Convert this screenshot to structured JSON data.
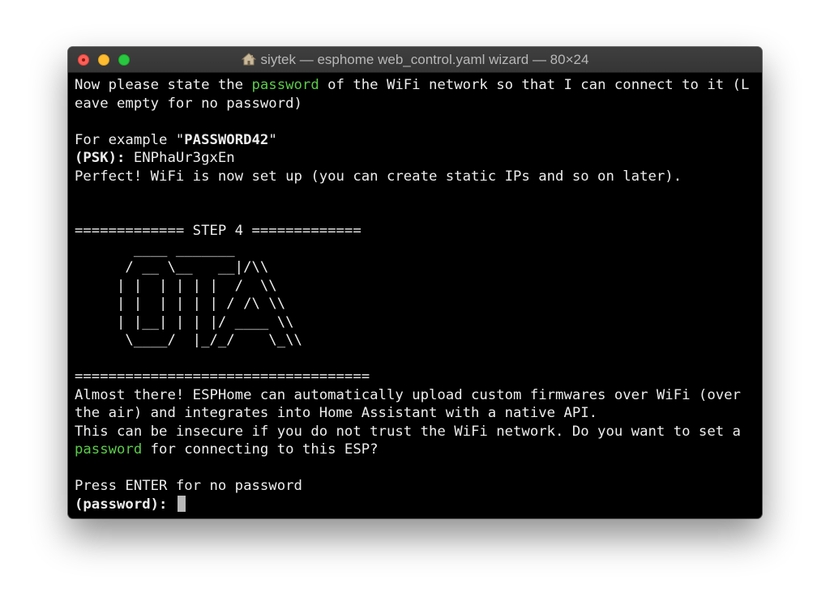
{
  "window": {
    "title": "siytek — esphome web_control.yaml wizard — 80×24",
    "title_icon": "home-icon",
    "buttons": [
      "close",
      "minimize",
      "zoom"
    ]
  },
  "terminal": {
    "line1": {
      "a": "Now please state the ",
      "b": "password",
      "c": " of the WiFi network so that I can connect to it (L"
    },
    "line2": "eave empty for no password)",
    "line3": "",
    "line4": {
      "a": "For example \"",
      "b": "PASSWORD42",
      "c": "\""
    },
    "line5": {
      "a": "(PSK):",
      "b": " ENPhaUr3gxEn"
    },
    "line6": "Perfect! WiFi is now set up (you can create static IPs and so on later).",
    "line7": "",
    "line8": "",
    "line9": "============= STEP 4 =============",
    "ascii1": "       ____ _______",
    "ascii2": "      / __ \\__   __|/\\\\",
    "ascii3": "     | |  | | | |  /  \\\\",
    "ascii4": "     | |  | | | | / /\\ \\\\",
    "ascii5": "     | |__| | | |/ ____ \\\\",
    "ascii6": "      \\____/  |_/_/    \\_\\\\",
    "line16": "",
    "line17": "===================================",
    "line18": "Almost there! ESPHome can automatically upload custom firmwares over WiFi (over",
    "line19": "the air) and integrates into Home Assistant with a native API.",
    "line20": "This can be insecure if you do not trust the WiFi network. Do you want to set a",
    "line21": {
      "a": "password",
      "b": " for connecting to this ESP?"
    },
    "line22": "",
    "line23": "Press ENTER for no password",
    "prompt": "(password):"
  },
  "colors": {
    "background": "#000000",
    "text": "#ededed",
    "highlight": "#5ccb4a",
    "titlebar": "#3a3a3a"
  }
}
